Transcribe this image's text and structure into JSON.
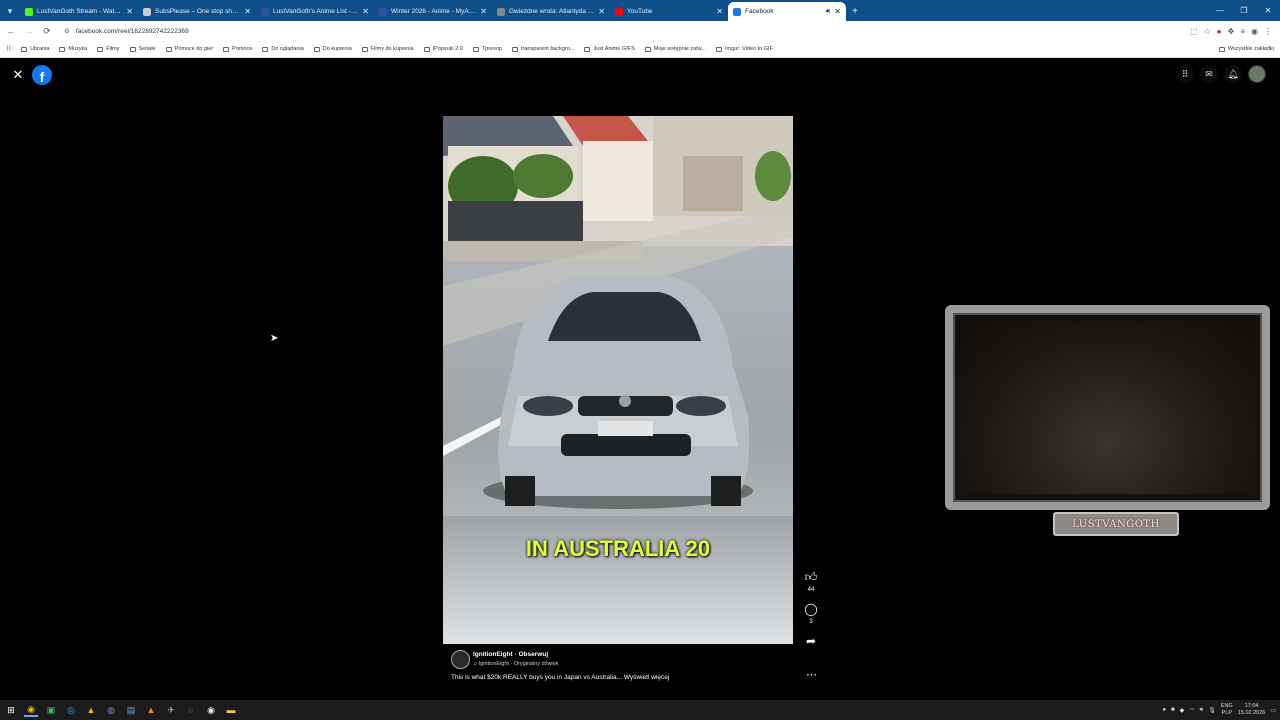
{
  "browser": {
    "tabs": [
      {
        "title": "LustVanGoth Stream - Watch Li",
        "fav_color": "#53fc18",
        "active": false
      },
      {
        "title": "SubsPlease – One stop shop fo",
        "fav_color": "#cccccc",
        "active": false
      },
      {
        "title": "LustVanGoth's Anime List - My",
        "fav_color": "#2e51a2",
        "active": false
      },
      {
        "title": "Winter 2026 - Anime - MyAnim",
        "fav_color": "#2e51a2",
        "active": false
      },
      {
        "title": "Gwiezdne wrota: Atlantyda / St",
        "fav_color": "#888888",
        "active": false
      },
      {
        "title": "YouTube",
        "fav_color": "#ff0000",
        "active": false
      },
      {
        "title": "Facebook",
        "fav_color": "#1877f2",
        "active": true
      }
    ],
    "url": "facebook.com/reel/1622892742222369",
    "bookmarks": [
      "Ubrania",
      "Muzyka",
      "Filmy",
      "Seriale",
      "Pomoce do gier",
      "Pomoce",
      "Do oglądania",
      "Do kupienia",
      "Filmy do kupienia",
      "|Popsuki 2.0",
      "Tpresop",
      "transparent backgro...",
      "Just Anime GIFS",
      "Moje wstępnie zatw...",
      "Imgur: Video to GIF"
    ],
    "bookmarks_right": "Wszystkie zakładki"
  },
  "reel": {
    "caption": "IN AUSTRALIA 20",
    "likes": "44",
    "comments": "3",
    "author": "IgnitionEight",
    "follow": "· Obserwuj",
    "audio": "IgnitionEight · Oryginalny dźwięk",
    "description": "This is what $20k REALLY buys you in Japan vs Australia... Wyświetl więcej"
  },
  "overlay": {
    "plate": "LUSTVANGOTH"
  },
  "taskbar": {
    "lang_top": "ENG",
    "lang_bottom": "PLP",
    "time": "17:04",
    "date": "15.02.2026"
  },
  "colors": {
    "tabstrip": "#0e4f8a",
    "facebook_blue": "#1877f2",
    "caption_yellow": "#e6ff2e"
  }
}
